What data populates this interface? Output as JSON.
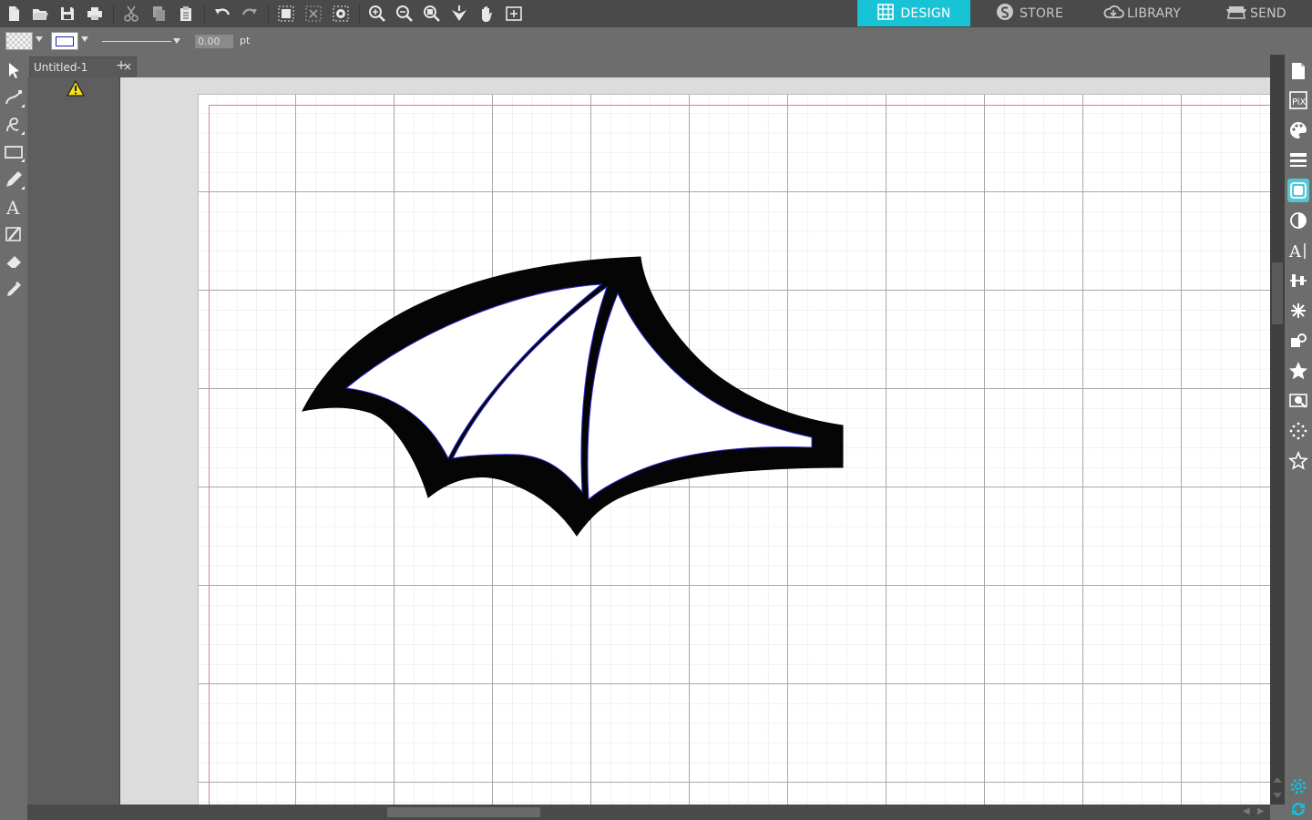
{
  "app": {
    "document_tab": "Untitled-1",
    "add_tab_label": "+",
    "close_tab_label": "×"
  },
  "nav_tabs": [
    {
      "label": "DESIGN",
      "icon": "grid-icon",
      "active": true
    },
    {
      "label": "STORE",
      "icon": "s-logo-icon",
      "active": false
    },
    {
      "label": "LIBRARY",
      "icon": "cloud-download-icon",
      "active": false
    },
    {
      "label": "SEND",
      "icon": "cutter-icon",
      "active": false
    }
  ],
  "top_toolbar_icons": [
    "new-document-icon",
    "open-folder-icon",
    "save-icon",
    "print-icon",
    "cut-icon",
    "copy-icon",
    "paste-icon",
    "undo-icon",
    "redo-icon",
    "group-icon",
    "ungroup-icon",
    "compound-path-icon",
    "zoom-in-icon",
    "zoom-out-icon",
    "zoom-fit-icon",
    "move-down-icon",
    "hand-pan-icon",
    "fit-to-page-icon"
  ],
  "properties": {
    "line_weight_value": "0.00",
    "line_weight_unit": "pt"
  },
  "left_tools": [
    "select-arrow-icon",
    "edit-points-icon",
    "draw-bezier-icon",
    "rectangle-icon",
    "pencil-icon",
    "text-icon",
    "knife-icon",
    "eraser-icon",
    "eyedropper-icon"
  ],
  "right_panel_icons": [
    "page-setup-icon",
    "pixscan-icon",
    "fill-color-icon",
    "line-style-icon",
    "cut-settings-icon",
    "transparency-icon",
    "text-style-icon",
    "align-icon",
    "replicate-icon",
    "modify-icon",
    "star-icon",
    "trace-icon",
    "offset-icon",
    "rhinestone-icon",
    "gear-icon",
    "sync-icon"
  ],
  "colors": {
    "accent": "#18c3d6",
    "toolbar_bg": "#4a4a4a",
    "panel_bg": "#6d6d6d",
    "cut_line": "#3a3acc",
    "margin_line": "#e06060"
  }
}
